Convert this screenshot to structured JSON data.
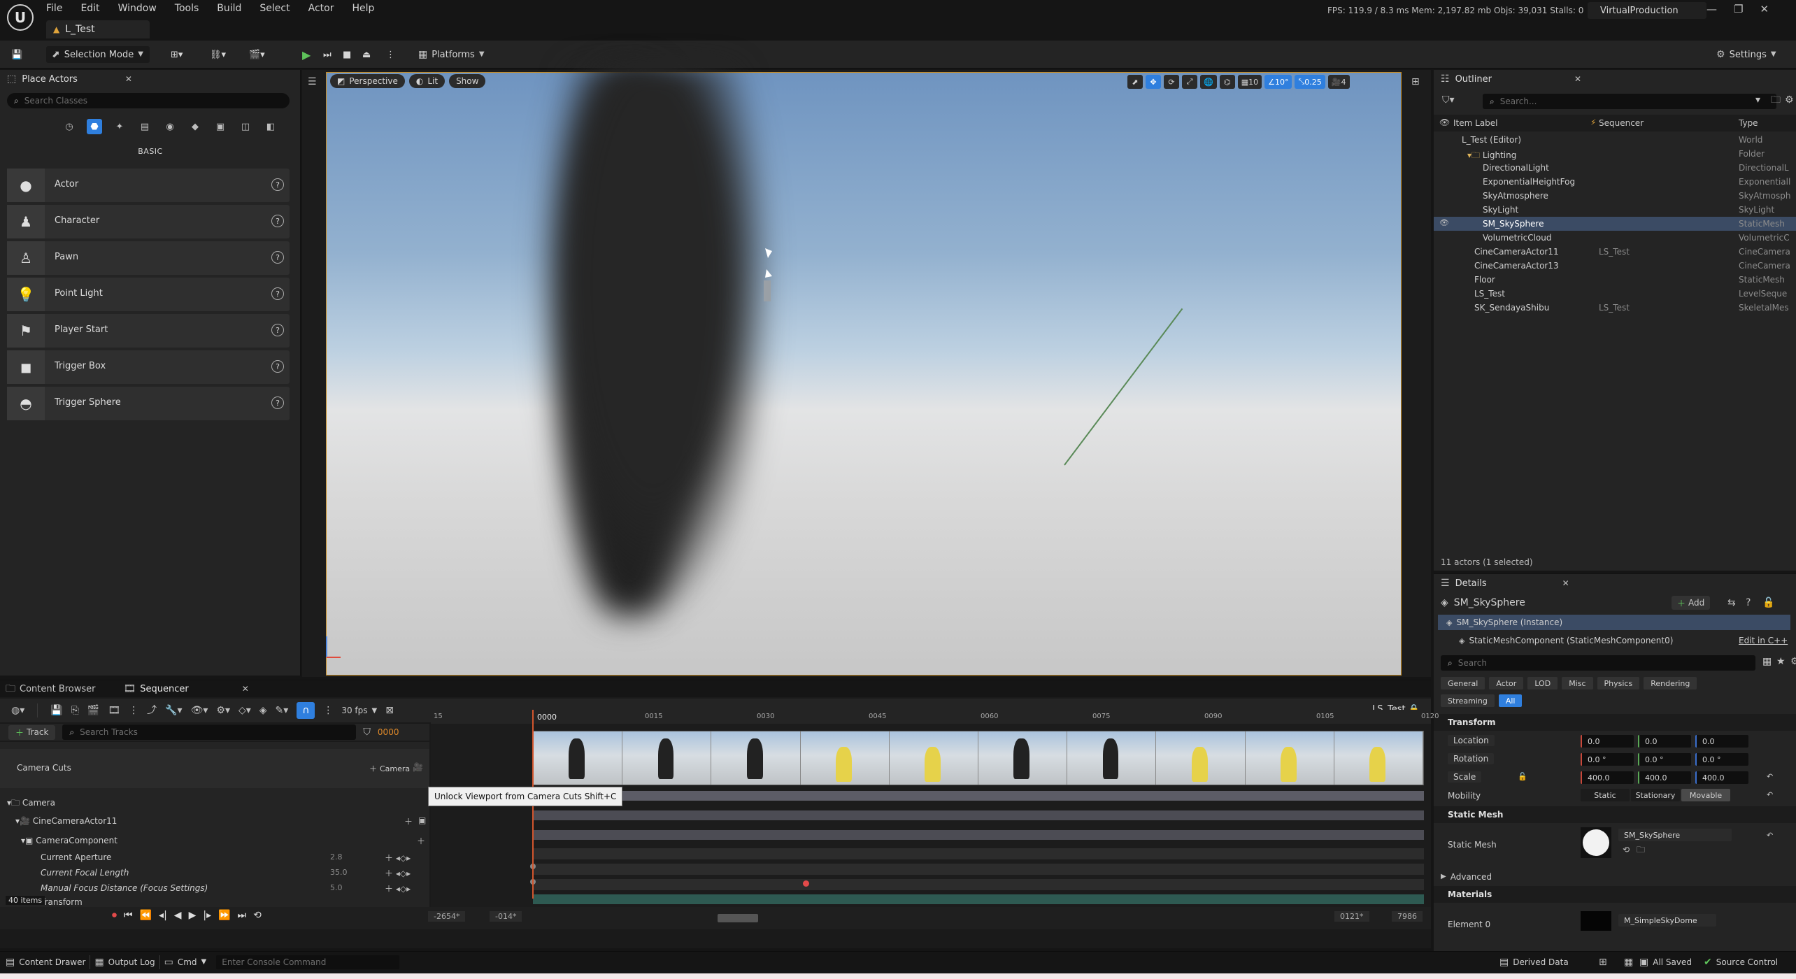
{
  "app": {
    "menu": [
      "File",
      "Edit",
      "Window",
      "Tools",
      "Build",
      "Select",
      "Actor",
      "Help"
    ],
    "level_tab": "L_Test",
    "stats": "FPS: 119.9  /  8.3 ms  Mem: 2,197.82 mb  Objs: 39,031  Stalls: 0",
    "project": "VirtualProduction"
  },
  "toolbar": {
    "selection_mode": "Selection Mode",
    "platforms": "Platforms",
    "settings": "Settings"
  },
  "place_actors": {
    "tab": "Place Actors",
    "search_placeholder": "Search Classes",
    "category": "BASIC",
    "items": [
      "Actor",
      "Character",
      "Pawn",
      "Point Light",
      "Player Start",
      "Trigger Box",
      "Trigger Sphere"
    ]
  },
  "viewport": {
    "perspective": "Perspective",
    "lit": "Lit",
    "show": "Show",
    "grid": "10",
    "angle": "10°",
    "scale": "0.25",
    "camera_speed": "4"
  },
  "outliner": {
    "tab": "Outliner",
    "search_placeholder": "Search...",
    "col_label": "Item Label",
    "col_sequencer": "Sequencer",
    "col_type": "Type",
    "rows": [
      {
        "label": "L_Test (Editor)",
        "seq": "",
        "type": "World"
      },
      {
        "label": "Lighting",
        "seq": "",
        "type": "Folder"
      },
      {
        "label": "DirectionalLight",
        "seq": "",
        "type": "DirectionalL"
      },
      {
        "label": "ExponentialHeightFog",
        "seq": "",
        "type": "Exponentiall"
      },
      {
        "label": "SkyAtmosphere",
        "seq": "",
        "type": "SkyAtmosph"
      },
      {
        "label": "SkyLight",
        "seq": "",
        "type": "SkyLight"
      },
      {
        "label": "SM_SkySphere",
        "seq": "",
        "type": "StaticMesh"
      },
      {
        "label": "VolumetricCloud",
        "seq": "",
        "type": "VolumetricC"
      },
      {
        "label": "CineCameraActor11",
        "seq": "LS_Test",
        "type": "CineCamera"
      },
      {
        "label": "CineCameraActor13",
        "seq": "",
        "type": "CineCamera"
      },
      {
        "label": "Floor",
        "seq": "",
        "type": "StaticMesh"
      },
      {
        "label": "LS_Test",
        "seq": "",
        "type": "LevelSeque"
      },
      {
        "label": "SK_SendayaShibu",
        "seq": "LS_Test",
        "type": "SkeletalMes"
      }
    ],
    "count": "11 actors (1 selected)"
  },
  "details": {
    "tab": "Details",
    "object": "SM_SkySphere",
    "add": "Add",
    "instance": "SM_SkySphere (Instance)",
    "component": "StaticMeshComponent (StaticMeshComponent0)",
    "edit_cpp": "Edit in C++",
    "search_placeholder": "Search",
    "filters": [
      "General",
      "Actor",
      "LOD",
      "Misc",
      "Physics",
      "Rendering",
      "Streaming",
      "All"
    ],
    "transform": "Transform",
    "location": {
      "label": "Location",
      "x": "0.0",
      "y": "0.0",
      "z": "0.0"
    },
    "rotation": {
      "label": "Rotation",
      "x": "0.0 °",
      "y": "0.0 °",
      "z": "0.0 °"
    },
    "scale": {
      "label": "Scale",
      "x": "400.0",
      "y": "400.0",
      "z": "400.0"
    },
    "mobility": {
      "label": "Mobility",
      "options": [
        "Static",
        "Stationary",
        "Movable"
      ]
    },
    "static_mesh_section": "Static Mesh",
    "static_mesh_label": "Static Mesh",
    "static_mesh_value": "SM_SkySphere",
    "advanced": "Advanced",
    "materials": "Materials",
    "element0": "Element 0",
    "material_value": "M_SimpleSkyDome"
  },
  "bottom": {
    "tabs": [
      "Content Browser",
      "Sequencer"
    ],
    "fps": "30 fps",
    "sequence": "LS_Test",
    "track_btn": "Track",
    "search_tracks": "Search Tracks",
    "frame": "0000",
    "camera_cuts": "Camera Cuts",
    "camera_btn": "Camera",
    "tooltip": "Unlock Viewport from Camera Cuts Shift+C",
    "tracks": [
      {
        "label": "Camera",
        "val": ""
      },
      {
        "label": "CineCameraActor11",
        "val": ""
      },
      {
        "label": "CameraComponent",
        "val": ""
      },
      {
        "label": "Current Aperture",
        "val": "2.8"
      },
      {
        "label": "Current Focal Length",
        "val": "35.0"
      },
      {
        "label": "Manual Focus Distance (Focus Settings)",
        "val": "5.0"
      },
      {
        "label": "Transform",
        "val": ""
      }
    ],
    "items_count": "40 items",
    "ruler": [
      "15",
      "0000",
      "0015",
      "0030",
      "0045",
      "0060",
      "0075",
      "0090",
      "0105",
      "0120"
    ],
    "range_start": "-2654*",
    "range_in": "-014*",
    "range_out": "0121*",
    "range_end": "7986"
  },
  "status": {
    "content_drawer": "Content Drawer",
    "output_log": "Output Log",
    "cmd": "Cmd",
    "console_placeholder": "Enter Console Command",
    "derived_data": "Derived Data",
    "all_saved": "All Saved",
    "source_control": "Source Control"
  }
}
